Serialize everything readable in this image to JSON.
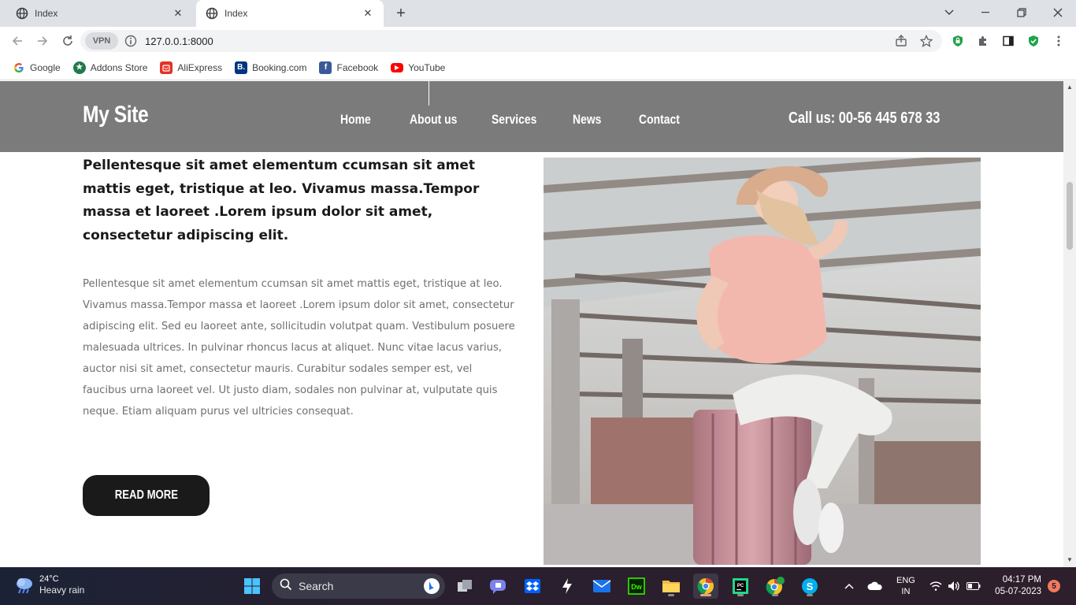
{
  "browser": {
    "tabs": [
      {
        "title": "Index",
        "active": false
      },
      {
        "title": "Index",
        "active": true
      }
    ],
    "new_tab": "+",
    "url": "127.0.0.1:8000",
    "vpn_label": "VPN",
    "bookmarks": [
      {
        "label": "Google",
        "icon": "google-icon"
      },
      {
        "label": "Addons Store",
        "icon": "addons-store-icon"
      },
      {
        "label": "AliExpress",
        "icon": "aliexpress-icon"
      },
      {
        "label": "Booking.com",
        "icon": "booking-icon"
      },
      {
        "label": "Facebook",
        "icon": "facebook-icon"
      },
      {
        "label": "YouTube",
        "icon": "youtube-icon"
      }
    ]
  },
  "site": {
    "logo": "My Site",
    "nav": [
      {
        "label": "Home"
      },
      {
        "label": "About us"
      },
      {
        "label": "Services"
      },
      {
        "label": "News"
      },
      {
        "label": "Contact"
      }
    ],
    "call": "Call us: 00-56 445 678 33",
    "lead": "Pellentesque sit amet elementum ccumsan sit amet mattis eget, tristique at leo. Vivamus massa.Tempor massa et laoreet .Lorem ipsum dolor sit amet, consectetur adipiscing elit.",
    "body": "Pellentesque sit amet elementum ccumsan sit amet mattis eget, tristique at leo. Vivamus massa.Tempor massa et laoreet .Lorem ipsum dolor sit amet, consectetur adipiscing elit. Sed eu laoreet ante, sollicitudin volutpat quam. Vestibulum posuere malesuada ultrices. In pulvinar rhoncus lacus at aliquet. Nunc vitae lacus varius, auctor nisi sit amet, consectetur mauris. Curabitur sodales semper est, vel faucibus urna laoreet vel. Ut justo diam, sodales non pulvinar at, vulputate quis neque. Etiam aliquam purus vel ultricies consequat.",
    "read_more": "READ MORE",
    "header_color": "#7b7b7b",
    "button_color": "#1a1a1a"
  },
  "taskbar": {
    "weather_temp": "24°C",
    "weather_condition": "Heavy rain",
    "search_label": "Search",
    "lang_line1": "ENG",
    "lang_line2": "IN",
    "time": "04:17 PM",
    "date": "05-07-2023",
    "notification_count": "5"
  }
}
